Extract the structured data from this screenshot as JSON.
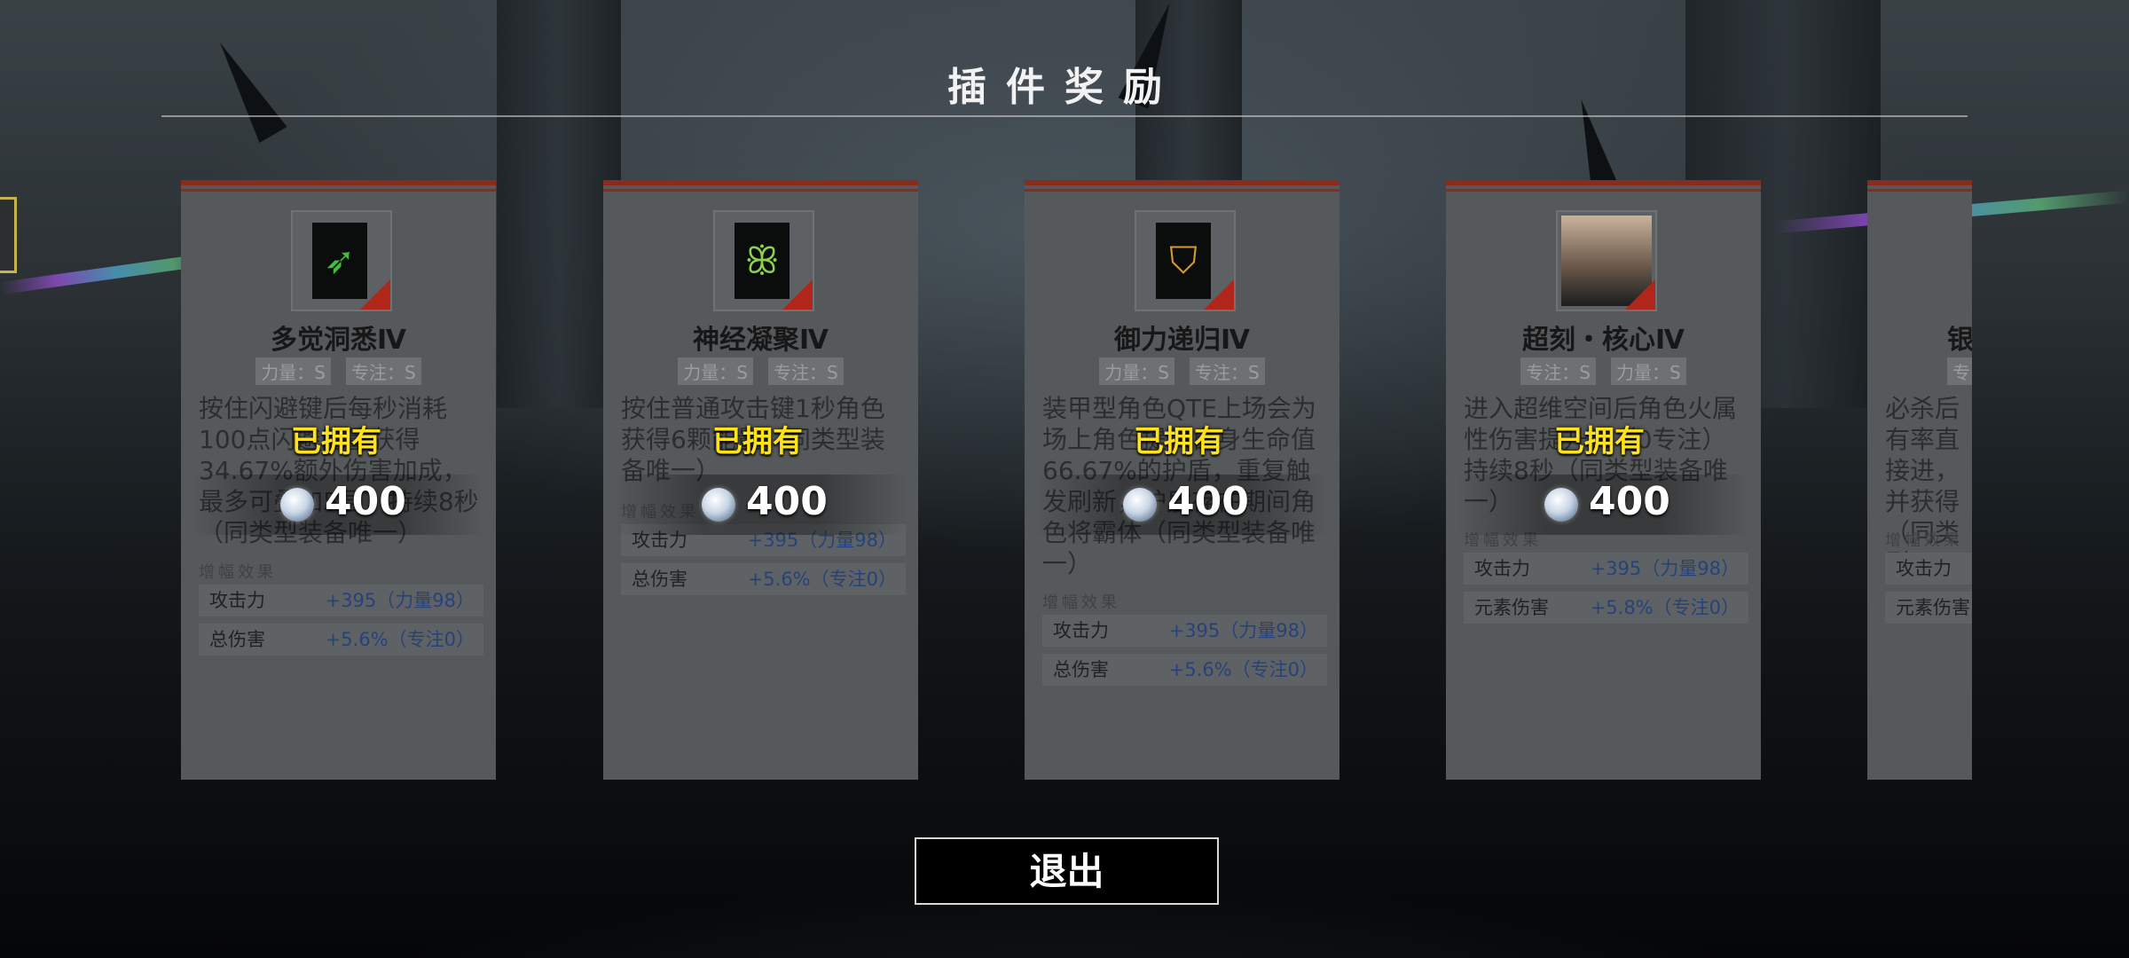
{
  "title": "插件奖励",
  "exit_label": "退出",
  "section_label": "增幅效果",
  "owned_label": "已拥有",
  "cards": [
    {
      "name": "多觉洞悉Ⅳ",
      "icon": "green-slash-icon",
      "tags": [
        "力量：S",
        "专注：S"
      ],
      "description": "按住闪避键后每秒消耗100点闪避能量获得34.67%额外伤害加成，最多可叠加5层，持续8秒（同类型装备唯一）",
      "stats": [
        {
          "key": "攻击力",
          "value": "+395（力量98）"
        },
        {
          "key": "总伤害",
          "value": "+5.6%（专注0）"
        }
      ],
      "price": "400"
    },
    {
      "name": "神经凝聚Ⅳ",
      "icon": "green-swirl-icon",
      "tags": [
        "力量：S",
        "专注：S"
      ],
      "description": "按住普通攻击键1秒角色获得6颗能量，同类型装备唯一）",
      "stats": [
        {
          "key": "攻击力",
          "value": "+395（力量98）"
        },
        {
          "key": "总伤害",
          "value": "+5.6%（专注0）"
        }
      ],
      "price": "400"
    },
    {
      "name": "御力递归Ⅳ",
      "icon": "gold-shield-icon",
      "tags": [
        "力量：S",
        "专注：S"
      ],
      "description": "装甲型角色QTE上场会为场上角色提供自身生命值66.67%的护盾，重复触发刷新，护盾存在期间角色将霸体（同类型装备唯一）",
      "stats": [
        {
          "key": "攻击力",
          "value": "+395（力量98）"
        },
        {
          "key": "总伤害",
          "value": "+5.6%（专注0）"
        }
      ],
      "price": "400"
    },
    {
      "name": "超刻・核心Ⅳ",
      "icon": "character-portrait-icon",
      "tags": [
        "专注：S",
        "力量：S"
      ],
      "description": "进入超维空间后角色火属性伤害提升%（0专注）持续8秒（同类型装备唯一）",
      "stats": [
        {
          "key": "攻击力",
          "value": "+395（力量98）"
        },
        {
          "key": "元素伤害",
          "value": "+5.8%（专注0）"
        }
      ],
      "price": "400"
    },
    {
      "name": "银",
      "icon": "partial-card-icon",
      "tags": [
        "专"
      ],
      "description": "必杀后有率直接进，并获得（同类型",
      "stats": [
        {
          "key": "攻击力",
          "value": ""
        },
        {
          "key": "元素伤害",
          "value": ""
        }
      ]
    }
  ]
}
